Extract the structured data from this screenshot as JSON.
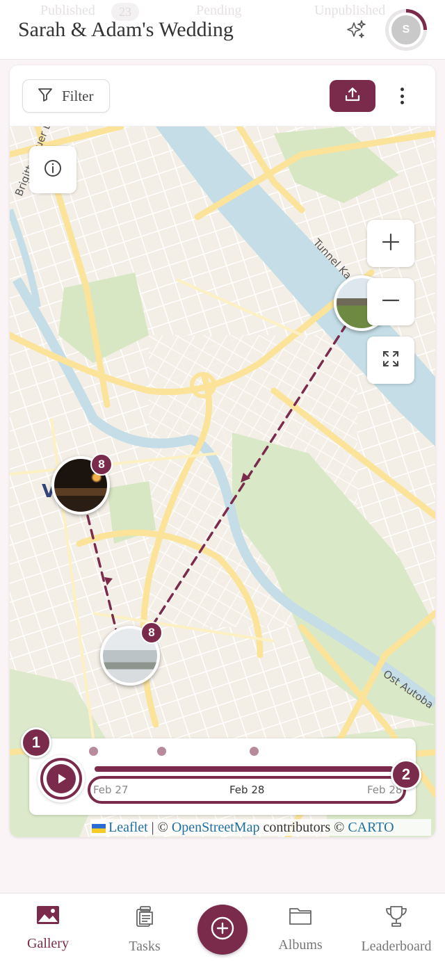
{
  "header": {
    "title": "Sarah & Adam's Wedding",
    "ghost_tabs": [
      "Published",
      "Pending",
      "Unpublished"
    ],
    "ghost_count": "23",
    "avatar_initial": "S"
  },
  "toolbar": {
    "filter_label": "Filter"
  },
  "map": {
    "labels": {
      "road_1": "Brigittenauer L",
      "road_2": "Tunnel Ka",
      "road_3": "Ost Autoba",
      "district": "V"
    },
    "markers": [
      {
        "name": "cluster-west",
        "count": "8"
      },
      {
        "name": "cluster-south",
        "count": "8"
      },
      {
        "name": "photo-northeast"
      }
    ],
    "route_color": "#7a2a4a"
  },
  "timeline": {
    "start_step": "1",
    "end_step": "2",
    "date_start": "Feb 27",
    "date_mid": "Feb 28",
    "date_end": "Feb 28"
  },
  "attribution": {
    "leaflet": "Leaflet",
    "sep": " | © ",
    "osm": "OpenStreetMap",
    "contrib": " contributors © ",
    "carto": "CARTO"
  },
  "nav": {
    "gallery": "Gallery",
    "tasks": "Tasks",
    "albums": "Albums",
    "leaderboard": "Leaderboard"
  },
  "colors": {
    "accent": "#7a2a4a",
    "water": "#c4dde6",
    "park": "#d7e6c3",
    "road": "#fbe39a"
  }
}
